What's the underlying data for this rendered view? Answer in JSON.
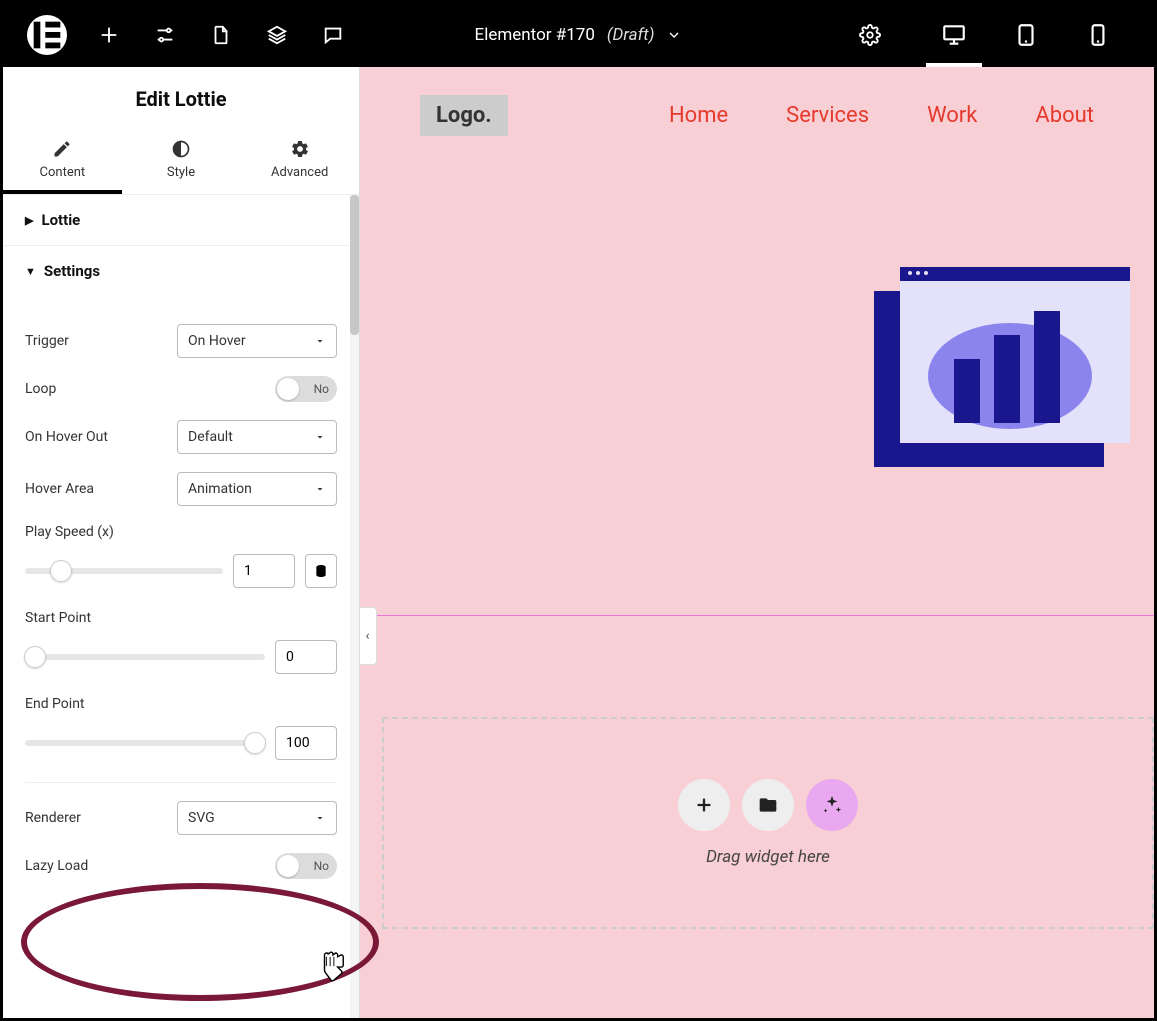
{
  "topbar": {
    "doc_title_prefix": "Elementor #170",
    "doc_status": "(Draft)"
  },
  "panel": {
    "title": "Edit Lottie",
    "tabs": {
      "content": "Content",
      "style": "Style",
      "advanced": "Advanced"
    },
    "sections": {
      "lottie": "Lottie",
      "settings": "Settings"
    },
    "labels": {
      "trigger": "Trigger",
      "loop": "Loop",
      "on_hover_out": "On Hover Out",
      "hover_area": "Hover Area",
      "play_speed": "Play Speed (x)",
      "start_point": "Start Point",
      "end_point": "End Point",
      "renderer": "Renderer",
      "lazy_load": "Lazy Load"
    },
    "values": {
      "trigger": "On Hover",
      "loop": "No",
      "on_hover_out": "Default",
      "hover_area": "Animation",
      "play_speed": "1",
      "start_point": "0",
      "end_point": "100",
      "renderer": "SVG",
      "lazy_load": "No"
    }
  },
  "canvas": {
    "logo_text": "Logo.",
    "nav": [
      "Home",
      "Services",
      "Work",
      "About"
    ],
    "drop_text": "Drag widget here"
  }
}
